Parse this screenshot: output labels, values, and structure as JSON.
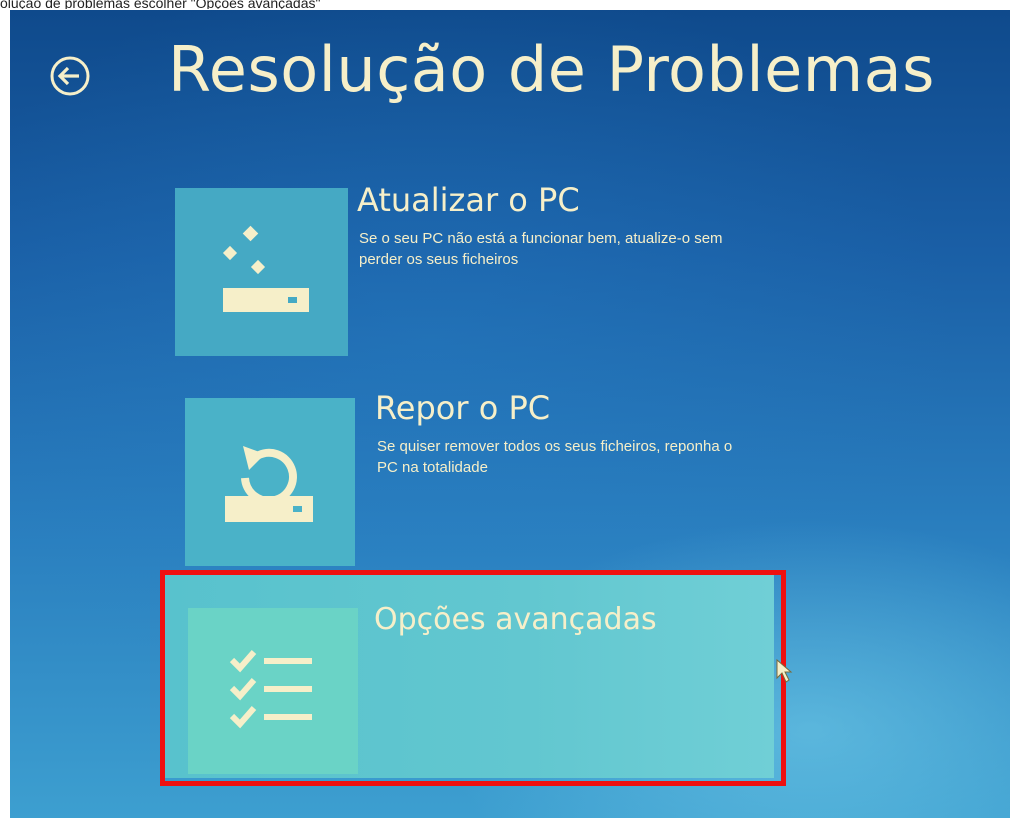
{
  "caption": "olução de problemas escolher \"Opções avançadas\"",
  "header": {
    "title": "Resolução de Problemas"
  },
  "options": [
    {
      "title": "Atualizar o PC",
      "description": "Se o seu PC não está a funcionar bem, atualize-o sem perder os seus ficheiros",
      "icon": "refresh-pc-icon"
    },
    {
      "title": "Repor o PC",
      "description": "Se quiser remover todos os seus ficheiros, reponha o PC na totalidade",
      "icon": "reset-pc-icon"
    },
    {
      "title": "Opções avançadas",
      "description": "",
      "icon": "checklist-icon"
    }
  ],
  "colors": {
    "background": "#1a5fa6",
    "text": "#f6efc9",
    "tile": "#4cb8c8",
    "highlight": "#ee1010"
  }
}
